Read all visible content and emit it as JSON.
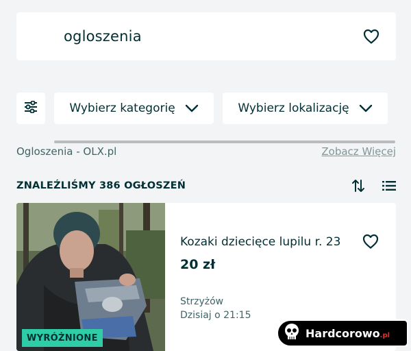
{
  "search": {
    "query": "ogloszenia"
  },
  "filters": {
    "category_label": "Wybierz kategorię",
    "location_label": "Wybierz lokalizację"
  },
  "source": {
    "label": "Ogloszenia - OLX.pl",
    "see_more": "Zobacz Więcej"
  },
  "results": {
    "count_label": "ZNALEŹLIŚMY 386 OGŁOSZEŃ"
  },
  "listing": {
    "title": "Kozaki dziecięce lupilu r. 23",
    "price": "20 zł",
    "location": "Strzyżów",
    "date": "Dzisiaj o 21:15",
    "badge": "WYRÓŻNIONE"
  },
  "watermark": {
    "brand": "Hardcorowo",
    "suffix": ".pl"
  },
  "icons": {
    "favorite": "heart-icon",
    "filters": "sliders-icon",
    "dropdown": "chevron-down-icon",
    "sort": "sort-arrows-icon",
    "view": "list-view-icon",
    "watermark": "skull-icon"
  },
  "colors": {
    "background": "#f2f4f5",
    "card": "#ffffff",
    "text": "#002f34",
    "badge": "#2fcda6"
  }
}
